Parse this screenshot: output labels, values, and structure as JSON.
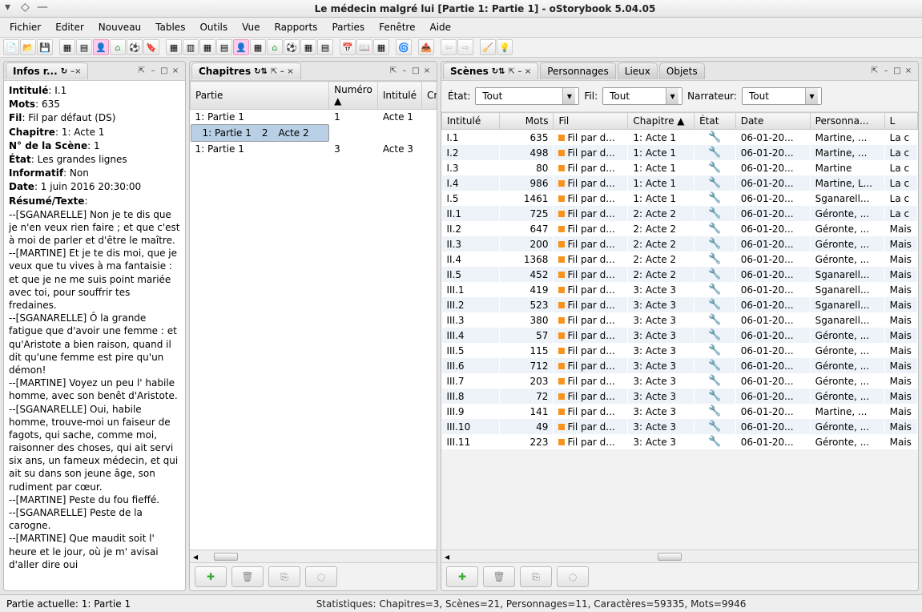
{
  "window_title": "Le médecin malgré lui [Partie 1: Partie 1] - oStorybook 5.04.05",
  "menu": [
    "Fichier",
    "Editer",
    "Nouveau",
    "Tables",
    "Outils",
    "Vue",
    "Rapports",
    "Parties",
    "Fenêtre",
    "Aide"
  ],
  "info": {
    "title": "Infos r...",
    "labels": {
      "intitule": "Intitulé",
      "mots": "Mots",
      "fil": "Fil",
      "chapitre": "Chapitre",
      "nscene": "N° de la Scène",
      "etat": "État",
      "informatif": "Informatif",
      "date": "Date",
      "resume": "Résumé/Texte"
    },
    "values": {
      "intitule": "I.1",
      "mots": "635",
      "fil": "Fil par défaut (DS)",
      "chapitre": "1: Acte 1",
      "nscene": "1",
      "etat": "Les grandes lignes",
      "informatif": "Non",
      "date": "1 juin 2016 20:30:00"
    },
    "summary": "--[SGANARELLE] Non je te dis que je n'en veux rien faire ; et que c'est à moi de parler et d'être le maître.\n--[MARTINE] Et je te dis moi, que je veux que tu vives à ma fantaisie : et que je ne me suis point mariée avec toi, pour souffrir tes fredaines.\n--[SGANARELLE] Ô la grande fatigue que d'avoir une femme : et qu'Aristote a bien raison, quand il dit qu'une femme est pire qu'un démon!\n--[MARTINE] Voyez un peu l' habile homme, avec son benêt d'Aristote.\n--[SGANARELLE] Oui, habile homme, trouve-moi un faiseur de fagots, qui sache, comme moi, raisonner des choses, qui ait servi six ans, un fameux médecin, et qui ait su dans son jeune âge, son rudiment par cœur.\n--[MARTINE] Peste du fou fieffé.\n--[SGANARELLE] Peste de la carogne.\n--[MARTINE] Que maudit soit l' heure et le jour, où je m' avisai d'aller dire oui"
  },
  "chapters": {
    "title": "Chapitres",
    "cols": [
      "Partie",
      "Numéro ▲",
      "Intitulé",
      "Créatio"
    ],
    "rows": [
      {
        "partie": "1: Partie 1",
        "num": "1",
        "intitule": "Acte 1"
      },
      {
        "partie": "1: Partie 1",
        "num": "2",
        "intitule": "Acte 2"
      },
      {
        "partie": "1: Partie 1",
        "num": "3",
        "intitule": "Acte 3"
      }
    ]
  },
  "scenes": {
    "tabs": [
      "Scènes",
      "Personnages",
      "Lieux",
      "Objets"
    ],
    "filters": {
      "etat_label": "État:",
      "etat_value": "Tout",
      "fil_label": "Fil:",
      "fil_value": "Tout",
      "narr_label": "Narrateur:",
      "narr_value": "Tout"
    },
    "cols": [
      "Intitulé",
      "Mots",
      "Fil",
      "Chapitre ▲",
      "État",
      "Date",
      "Personna...",
      "L"
    ],
    "rows": [
      {
        "i": "I.1",
        "m": "635",
        "f": "Fil par d...",
        "c": "1: Acte 1",
        "d": "06-01-20...",
        "p": "Martine, ...",
        "l": "La c"
      },
      {
        "i": "I.2",
        "m": "498",
        "f": "Fil par d...",
        "c": "1: Acte 1",
        "d": "06-01-20...",
        "p": "Martine, ...",
        "l": "La c"
      },
      {
        "i": "I.3",
        "m": "80",
        "f": "Fil par d...",
        "c": "1: Acte 1",
        "d": "06-01-20...",
        "p": "Martine",
        "l": "La c"
      },
      {
        "i": "I.4",
        "m": "986",
        "f": "Fil par d...",
        "c": "1: Acte 1",
        "d": "06-01-20...",
        "p": "Martine, L...",
        "l": "La c"
      },
      {
        "i": "I.5",
        "m": "1461",
        "f": "Fil par d...",
        "c": "1: Acte 1",
        "d": "06-01-20...",
        "p": "Sganarell...",
        "l": "La c"
      },
      {
        "i": "II.1",
        "m": "725",
        "f": "Fil par d...",
        "c": "2: Acte 2",
        "d": "06-01-20...",
        "p": "Géronte, ...",
        "l": "La c"
      },
      {
        "i": "II.2",
        "m": "647",
        "f": "Fil par d...",
        "c": "2: Acte 2",
        "d": "06-01-20...",
        "p": "Géronte, ...",
        "l": "Mais"
      },
      {
        "i": "II.3",
        "m": "200",
        "f": "Fil par d...",
        "c": "2: Acte 2",
        "d": "06-01-20...",
        "p": "Géronte, ...",
        "l": "Mais"
      },
      {
        "i": "II.4",
        "m": "1368",
        "f": "Fil par d...",
        "c": "2: Acte 2",
        "d": "06-01-20...",
        "p": "Géronte, ...",
        "l": "Mais"
      },
      {
        "i": "II.5",
        "m": "452",
        "f": "Fil par d...",
        "c": "2: Acte 2",
        "d": "06-01-20...",
        "p": "Sganarell...",
        "l": "Mais"
      },
      {
        "i": "III.1",
        "m": "419",
        "f": "Fil par d...",
        "c": "3: Acte 3",
        "d": "06-01-20...",
        "p": "Sganarell...",
        "l": "Mais"
      },
      {
        "i": "III.2",
        "m": "523",
        "f": "Fil par d...",
        "c": "3: Acte 3",
        "d": "06-01-20...",
        "p": "Sganarell...",
        "l": "Mais"
      },
      {
        "i": "III.3",
        "m": "380",
        "f": "Fil par d...",
        "c": "3: Acte 3",
        "d": "06-01-20...",
        "p": "Sganarell...",
        "l": "Mais"
      },
      {
        "i": "III.4",
        "m": "57",
        "f": "Fil par d...",
        "c": "3: Acte 3",
        "d": "06-01-20...",
        "p": "Géronte, ...",
        "l": "Mais"
      },
      {
        "i": "III.5",
        "m": "115",
        "f": "Fil par d...",
        "c": "3: Acte 3",
        "d": "06-01-20...",
        "p": "Géronte, ...",
        "l": "Mais"
      },
      {
        "i": "III.6",
        "m": "712",
        "f": "Fil par d...",
        "c": "3: Acte 3",
        "d": "06-01-20...",
        "p": "Géronte, ...",
        "l": "Mais"
      },
      {
        "i": "III.7",
        "m": "203",
        "f": "Fil par d...",
        "c": "3: Acte 3",
        "d": "06-01-20...",
        "p": "Géronte, ...",
        "l": "Mais"
      },
      {
        "i": "III.8",
        "m": "72",
        "f": "Fil par d...",
        "c": "3: Acte 3",
        "d": "06-01-20...",
        "p": "Géronte, ...",
        "l": "Mais"
      },
      {
        "i": "III.9",
        "m": "141",
        "f": "Fil par d...",
        "c": "3: Acte 3",
        "d": "06-01-20...",
        "p": "Martine, ...",
        "l": "Mais"
      },
      {
        "i": "III.10",
        "m": "49",
        "f": "Fil par d...",
        "c": "3: Acte 3",
        "d": "06-01-20...",
        "p": "Géronte, ...",
        "l": "Mais"
      },
      {
        "i": "III.11",
        "m": "223",
        "f": "Fil par d...",
        "c": "3: Acte 3",
        "d": "06-01-20...",
        "p": "Géronte, ...",
        "l": "Mais"
      }
    ]
  },
  "status": {
    "left": "Partie actuelle: 1: Partie 1",
    "stats": "Statistiques: Chapitres=3,  Scènes=21,  Personnages=11,  Caractères=59335,  Mots=9946"
  }
}
